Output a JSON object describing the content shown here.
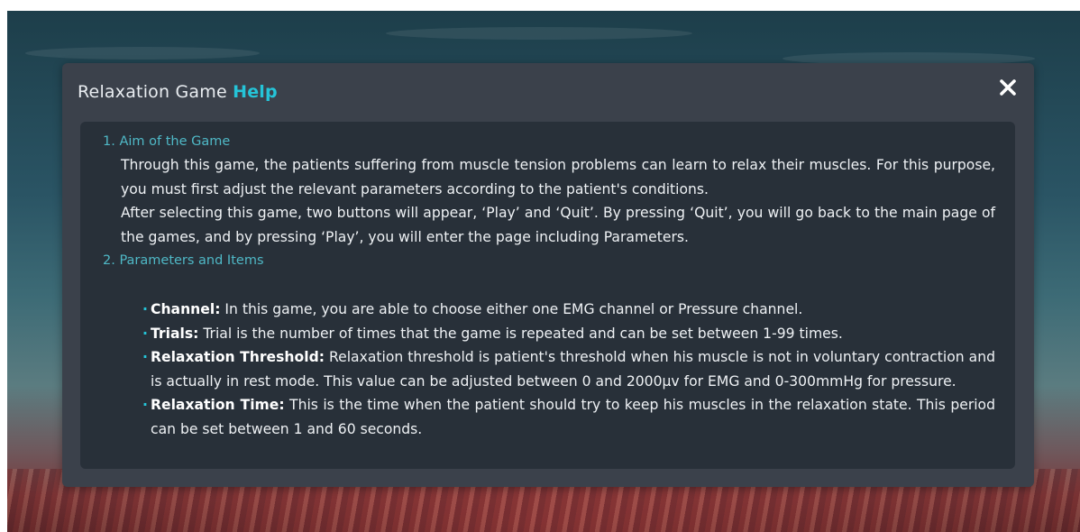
{
  "modal": {
    "title_prefix": "Relaxation Game ",
    "title_accent": "Help",
    "close_icon": "close-icon"
  },
  "sections": [
    {
      "title": "1. Aim of the Game",
      "paragraphs": [
        "Through this game, the patients suffering from muscle tension problems can learn to relax their muscles. For this purpose, you must first adjust the relevant parameters according to the patient's conditions.",
        "After selecting this game, two buttons will appear, ‘Play’ and ‘Quit’. By pressing ‘Quit’, you will go back to the main page of the games, and by pressing ‘Play’, you will enter the page including Parameters."
      ]
    },
    {
      "title": "2. Parameters and Items",
      "items": [
        {
          "term": "Channel:",
          "text": " In this game, you are able to choose either one EMG channel or Pressure channel."
        },
        {
          "term": "Trials:",
          "text": " Trial is the number of times that the game is repeated and can be set between 1-99 times."
        },
        {
          "term": "Relaxation Threshold:",
          "text": " Relaxation threshold is patient's threshold when his muscle is not in voluntary contraction and is actually in rest mode. This value can be adjusted between 0 and 2000μv for EMG and 0-300mmHg for pressure."
        },
        {
          "term": "Relaxation Time:",
          "text": " This is the time when the patient should try to keep his muscles in the relaxation state. This period can be set between 1 and 60 seconds."
        }
      ]
    }
  ],
  "colors": {
    "accent": "#25c4d8",
    "modal_bg": "#3b414b",
    "panel_bg": "#283039",
    "section_title": "#4fb8c6"
  }
}
